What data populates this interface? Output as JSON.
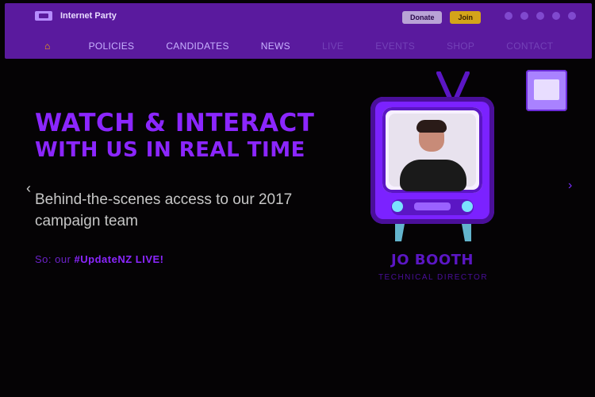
{
  "app": {
    "name": "Internet Party"
  },
  "top_actions": [
    {
      "label": "Donate",
      "style": "gray"
    },
    {
      "label": "Join",
      "style": "gold"
    }
  ],
  "social_icons": [
    "facebook-icon",
    "twitter-icon",
    "youtube-icon",
    "instagram-icon",
    "google-plus-icon"
  ],
  "nav": {
    "home_icon": "home-icon",
    "items": [
      {
        "label": "POLICIES",
        "dim": false
      },
      {
        "label": "CANDIDATES",
        "dim": false
      },
      {
        "label": "NEWS",
        "dim": false
      },
      {
        "label": "LIVE",
        "dim": true
      },
      {
        "label": "EVENTS",
        "dim": true
      },
      {
        "label": "SHOP",
        "dim": true
      },
      {
        "label": "CONTACT",
        "dim": true
      }
    ]
  },
  "hero": {
    "headline_line1": "WATCH & INTERACT",
    "headline_line2": "WITH US IN REAL TIME",
    "subhead": "Behind-the-scenes access to our 2017 campaign team",
    "cta_prefix": "So: our",
    "cta_tag": "#UpdateNZ LIVE!",
    "colors": {
      "accent": "#8b26ff",
      "subhead": "#c6c6c6"
    }
  },
  "presenter": {
    "name": "JO BOOTH",
    "role": "TECHNICAL DIRECTOR"
  },
  "carousel": {
    "prev_icon": "chevron-left-icon",
    "next_icon": "chevron-right-icon"
  }
}
